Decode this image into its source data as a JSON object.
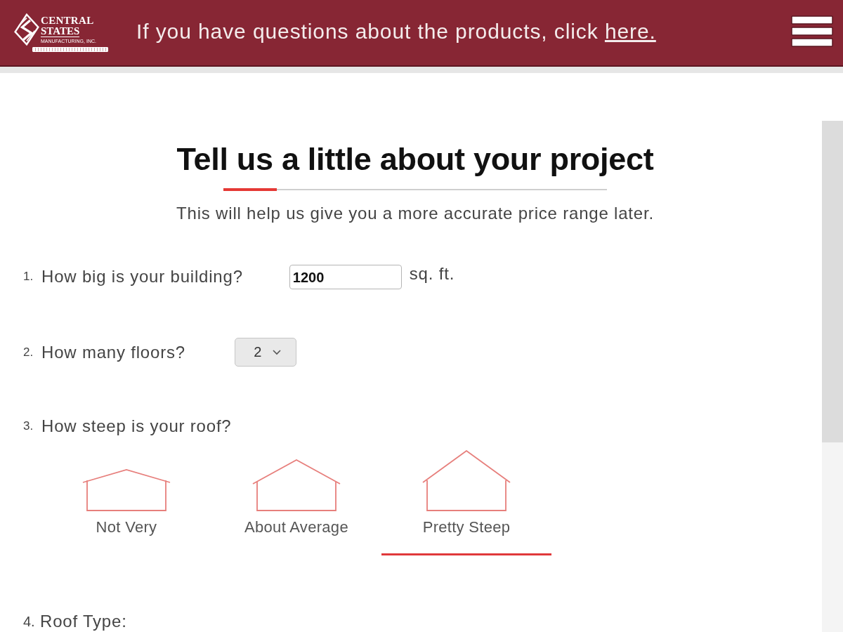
{
  "header": {
    "logo": {
      "lines": [
        "CENTRAL",
        "STATES",
        "MANUFACTURING, INC."
      ]
    },
    "notice": "If you have questions about the products, click",
    "link": "here."
  },
  "intro": {
    "title": "Tell us a little about your project",
    "progress": {
      "level": 0.14
    },
    "subtitle": "This will help us give you a more accurate price range later."
  },
  "questions": [
    {
      "kind": "number_input",
      "number": "1.",
      "label": "How big is your building?",
      "value": "1200",
      "unit": "sq. ft."
    },
    {
      "kind": "select",
      "number": "2.",
      "label": "How many floors?",
      "value": "2"
    },
    {
      "kind": "choice",
      "number": "3.",
      "label": "How steep is your roof?",
      "options": [
        {
          "label": "Not Very",
          "selected": false
        },
        {
          "label": "About Average",
          "selected": false
        },
        {
          "label": "Pretty Steep",
          "selected": true
        }
      ]
    },
    {
      "kind": "heading",
      "number": "4.",
      "label": "Roof Type:"
    }
  ]
}
